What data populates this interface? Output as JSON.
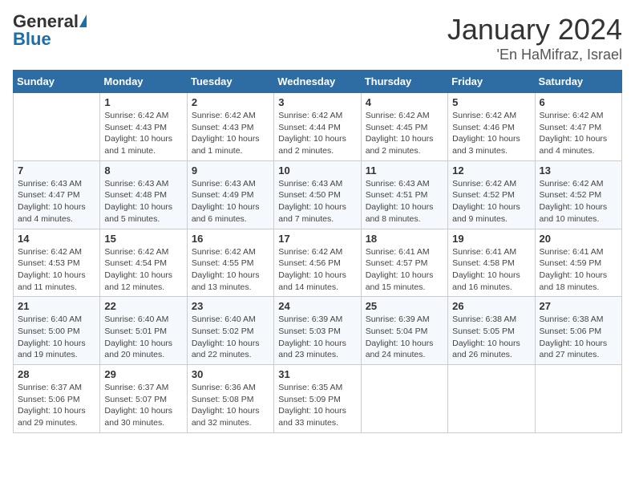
{
  "header": {
    "logo_general": "General",
    "logo_blue": "Blue",
    "title": "January 2024",
    "subtitle": "'En HaMifraz, Israel"
  },
  "days_of_week": [
    "Sunday",
    "Monday",
    "Tuesday",
    "Wednesday",
    "Thursday",
    "Friday",
    "Saturday"
  ],
  "weeks": [
    [
      {
        "day": "",
        "info": ""
      },
      {
        "day": "1",
        "info": "Sunrise: 6:42 AM\nSunset: 4:43 PM\nDaylight: 10 hours\nand 1 minute."
      },
      {
        "day": "2",
        "info": "Sunrise: 6:42 AM\nSunset: 4:43 PM\nDaylight: 10 hours\nand 1 minute."
      },
      {
        "day": "3",
        "info": "Sunrise: 6:42 AM\nSunset: 4:44 PM\nDaylight: 10 hours\nand 2 minutes."
      },
      {
        "day": "4",
        "info": "Sunrise: 6:42 AM\nSunset: 4:45 PM\nDaylight: 10 hours\nand 2 minutes."
      },
      {
        "day": "5",
        "info": "Sunrise: 6:42 AM\nSunset: 4:46 PM\nDaylight: 10 hours\nand 3 minutes."
      },
      {
        "day": "6",
        "info": "Sunrise: 6:42 AM\nSunset: 4:47 PM\nDaylight: 10 hours\nand 4 minutes."
      }
    ],
    [
      {
        "day": "7",
        "info": "Sunrise: 6:43 AM\nSunset: 4:47 PM\nDaylight: 10 hours\nand 4 minutes."
      },
      {
        "day": "8",
        "info": "Sunrise: 6:43 AM\nSunset: 4:48 PM\nDaylight: 10 hours\nand 5 minutes."
      },
      {
        "day": "9",
        "info": "Sunrise: 6:43 AM\nSunset: 4:49 PM\nDaylight: 10 hours\nand 6 minutes."
      },
      {
        "day": "10",
        "info": "Sunrise: 6:43 AM\nSunset: 4:50 PM\nDaylight: 10 hours\nand 7 minutes."
      },
      {
        "day": "11",
        "info": "Sunrise: 6:43 AM\nSunset: 4:51 PM\nDaylight: 10 hours\nand 8 minutes."
      },
      {
        "day": "12",
        "info": "Sunrise: 6:42 AM\nSunset: 4:52 PM\nDaylight: 10 hours\nand 9 minutes."
      },
      {
        "day": "13",
        "info": "Sunrise: 6:42 AM\nSunset: 4:52 PM\nDaylight: 10 hours\nand 10 minutes."
      }
    ],
    [
      {
        "day": "14",
        "info": "Sunrise: 6:42 AM\nSunset: 4:53 PM\nDaylight: 10 hours\nand 11 minutes."
      },
      {
        "day": "15",
        "info": "Sunrise: 6:42 AM\nSunset: 4:54 PM\nDaylight: 10 hours\nand 12 minutes."
      },
      {
        "day": "16",
        "info": "Sunrise: 6:42 AM\nSunset: 4:55 PM\nDaylight: 10 hours\nand 13 minutes."
      },
      {
        "day": "17",
        "info": "Sunrise: 6:42 AM\nSunset: 4:56 PM\nDaylight: 10 hours\nand 14 minutes."
      },
      {
        "day": "18",
        "info": "Sunrise: 6:41 AM\nSunset: 4:57 PM\nDaylight: 10 hours\nand 15 minutes."
      },
      {
        "day": "19",
        "info": "Sunrise: 6:41 AM\nSunset: 4:58 PM\nDaylight: 10 hours\nand 16 minutes."
      },
      {
        "day": "20",
        "info": "Sunrise: 6:41 AM\nSunset: 4:59 PM\nDaylight: 10 hours\nand 18 minutes."
      }
    ],
    [
      {
        "day": "21",
        "info": "Sunrise: 6:40 AM\nSunset: 5:00 PM\nDaylight: 10 hours\nand 19 minutes."
      },
      {
        "day": "22",
        "info": "Sunrise: 6:40 AM\nSunset: 5:01 PM\nDaylight: 10 hours\nand 20 minutes."
      },
      {
        "day": "23",
        "info": "Sunrise: 6:40 AM\nSunset: 5:02 PM\nDaylight: 10 hours\nand 22 minutes."
      },
      {
        "day": "24",
        "info": "Sunrise: 6:39 AM\nSunset: 5:03 PM\nDaylight: 10 hours\nand 23 minutes."
      },
      {
        "day": "25",
        "info": "Sunrise: 6:39 AM\nSunset: 5:04 PM\nDaylight: 10 hours\nand 24 minutes."
      },
      {
        "day": "26",
        "info": "Sunrise: 6:38 AM\nSunset: 5:05 PM\nDaylight: 10 hours\nand 26 minutes."
      },
      {
        "day": "27",
        "info": "Sunrise: 6:38 AM\nSunset: 5:06 PM\nDaylight: 10 hours\nand 27 minutes."
      }
    ],
    [
      {
        "day": "28",
        "info": "Sunrise: 6:37 AM\nSunset: 5:06 PM\nDaylight: 10 hours\nand 29 minutes."
      },
      {
        "day": "29",
        "info": "Sunrise: 6:37 AM\nSunset: 5:07 PM\nDaylight: 10 hours\nand 30 minutes."
      },
      {
        "day": "30",
        "info": "Sunrise: 6:36 AM\nSunset: 5:08 PM\nDaylight: 10 hours\nand 32 minutes."
      },
      {
        "day": "31",
        "info": "Sunrise: 6:35 AM\nSunset: 5:09 PM\nDaylight: 10 hours\nand 33 minutes."
      },
      {
        "day": "",
        "info": ""
      },
      {
        "day": "",
        "info": ""
      },
      {
        "day": "",
        "info": ""
      }
    ]
  ]
}
